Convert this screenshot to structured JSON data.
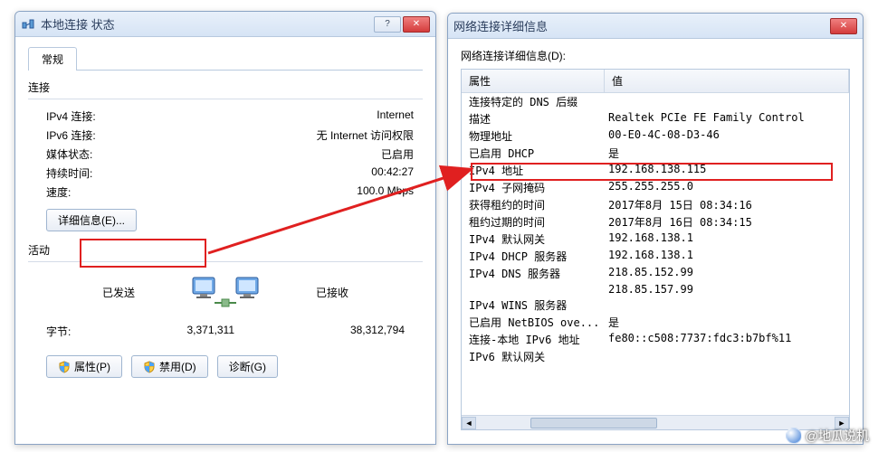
{
  "win1": {
    "title": "本地连接 状态",
    "tab_general": "常规",
    "group_connection": "连接",
    "rows": [
      {
        "k": "IPv4 连接:",
        "v": "Internet"
      },
      {
        "k": "IPv6 连接:",
        "v": "无 Internet 访问权限"
      },
      {
        "k": "媒体状态:",
        "v": "已启用"
      },
      {
        "k": "持续时间:",
        "v": "00:42:27"
      },
      {
        "k": "速度:",
        "v": "100.0 Mbps"
      }
    ],
    "details_btn": "详细信息(E)...",
    "group_activity": "活动",
    "sent_label": "已发送",
    "recv_label": "已接收",
    "bytes_label": "字节:",
    "bytes_sent": "3,371,311",
    "bytes_recv": "38,312,794",
    "btn_properties": "属性(P)",
    "btn_disable": "禁用(D)",
    "btn_diagnose": "诊断(G)"
  },
  "win2": {
    "title": "网络连接详细信息",
    "list_label": "网络连接详细信息(D):",
    "col_prop": "属性",
    "col_val": "值",
    "rows": [
      {
        "p": "连接特定的 DNS 后缀",
        "v": ""
      },
      {
        "p": "描述",
        "v": "Realtek PCIe FE Family Control"
      },
      {
        "p": "物理地址",
        "v": "00-E0-4C-08-D3-46"
      },
      {
        "p": "已启用 DHCP",
        "v": "是"
      },
      {
        "p": "IPv4 地址",
        "v": "192.168.138.115"
      },
      {
        "p": "IPv4 子网掩码",
        "v": "255.255.255.0"
      },
      {
        "p": "获得租约的时间",
        "v": "2017年8月 15日 08:34:16"
      },
      {
        "p": "租约过期的时间",
        "v": "2017年8月 16日 08:34:15"
      },
      {
        "p": "IPv4 默认网关",
        "v": "192.168.138.1"
      },
      {
        "p": "IPv4 DHCP 服务器",
        "v": "192.168.138.1"
      },
      {
        "p": "IPv4 DNS 服务器",
        "v": "218.85.152.99"
      },
      {
        "p": "",
        "v": "218.85.157.99"
      },
      {
        "p": "IPv4 WINS 服务器",
        "v": ""
      },
      {
        "p": "已启用 NetBIOS ove...",
        "v": "是"
      },
      {
        "p": "连接-本地 IPv6 地址",
        "v": "fe80::c508:7737:fdc3:b7bf%11"
      },
      {
        "p": "IPv6 默认网关",
        "v": ""
      }
    ]
  },
  "watermark": "@地瓜说机"
}
